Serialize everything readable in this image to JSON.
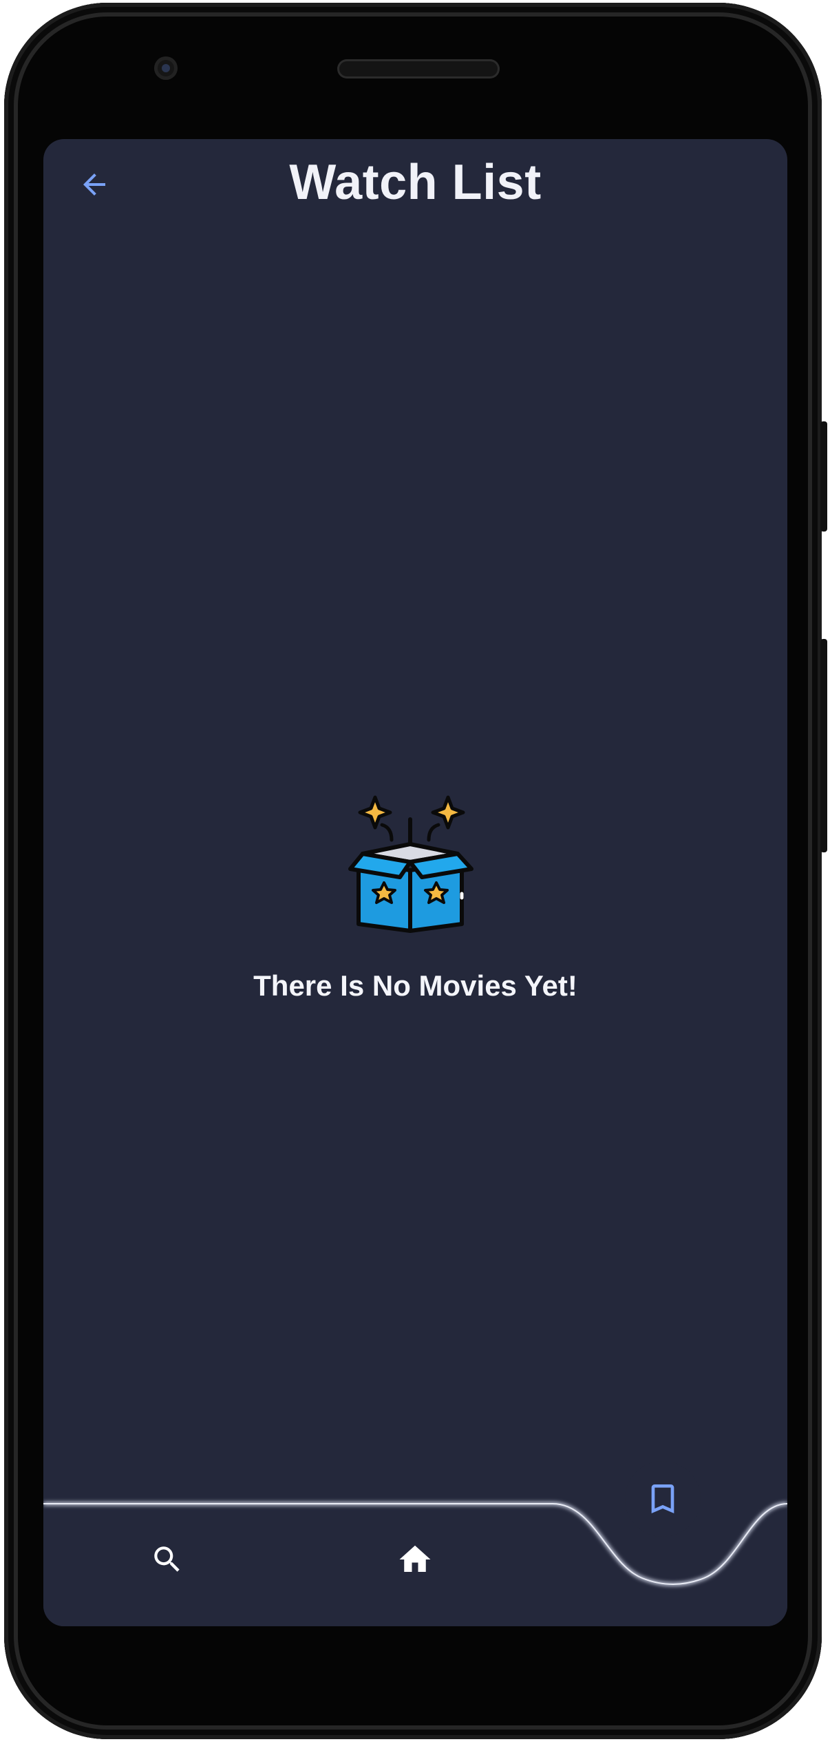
{
  "header": {
    "title": "Watch List",
    "back_icon": "arrow-back-icon"
  },
  "empty_state": {
    "icon": "open-box-icon",
    "message": "There Is No Movies Yet!"
  },
  "bottom_nav": {
    "items": [
      {
        "icon": "search-icon",
        "active": false
      },
      {
        "icon": "home-icon",
        "active": false
      },
      {
        "icon": "bookmark-icon",
        "active": true
      }
    ]
  },
  "colors": {
    "background": "#24283b",
    "accent": "#7aa2f7",
    "text": "#f1f2f8",
    "box_blue": "#1e9be0",
    "sparkle": "#f5b942"
  }
}
